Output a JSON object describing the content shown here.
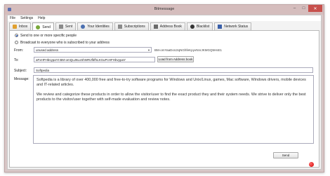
{
  "window": {
    "title": "Bitmessage"
  },
  "menu": [
    "File",
    "Settings",
    "Help"
  ],
  "tabs": [
    {
      "label": "Inbox",
      "icon": "inbox-icon",
      "color": "#e0a030"
    },
    {
      "label": "Send",
      "icon": "send-icon",
      "color": "#7aa83a"
    },
    {
      "label": "Sent",
      "icon": "sent-icon",
      "color": "#8a8a8a"
    },
    {
      "label": "Your Identities",
      "icon": "identities-icon",
      "color": "#4a6fb0"
    },
    {
      "label": "Subscriptions",
      "icon": "subscriptions-icon",
      "color": "#8a8a8a"
    },
    {
      "label": "Address Book",
      "icon": "address-book-icon",
      "color": "#6a6a6a"
    },
    {
      "label": "Blacklist",
      "icon": "blacklist-icon",
      "color": "#333333"
    },
    {
      "label": "Network Status",
      "icon": "network-status-icon",
      "color": "#3a5fa8"
    }
  ],
  "send": {
    "radio_specific": "Send to one or more specific people",
    "radio_broadcast": "Broadcast to everyone who is subscribed to your address",
    "from_label": "From:",
    "from_value": "unused address",
    "from_address": "BM-omYaaDoU2qNGhfeKpyvNnrJKMGQ5HsE1",
    "to_label": "To:",
    "to_value": "aFxHFHbvypaYt BM-omQuJ6LxShWRJfbfhLKGuPcHFHbvypaY",
    "load_button": "Load from Address book",
    "subject_label": "Subject:",
    "subject_value": "Softpedia",
    "message_label": "Message:",
    "message_p1": "Softpedia is a library of over 400,000 free and free-to-try software programs for Windows and Unix/Linux, games, Mac software, Windows drivers, mobile devices and IT-related articles.",
    "message_p2": "We review and categorize these products in order to allow the visitor/user to find the exact product they and their system needs. We strive to deliver only the best products to the visitor/user together with self-made evaluation and review notes.",
    "send_button": "Send"
  }
}
